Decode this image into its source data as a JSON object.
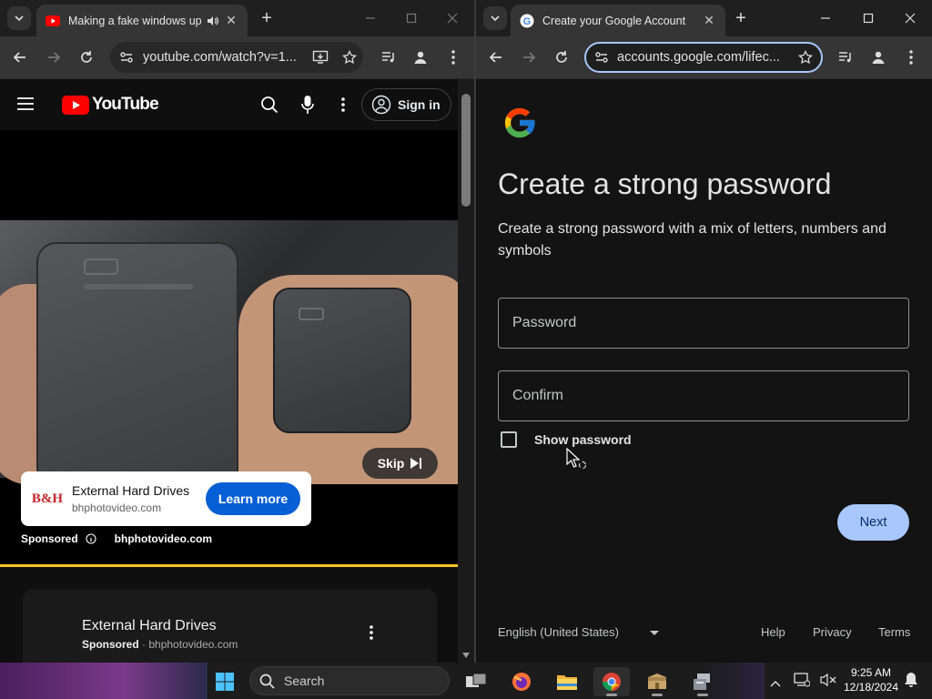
{
  "left_window": {
    "tab_title": "Making a fake windows up",
    "url": "youtube.com/watch?v=1...",
    "youtube": {
      "logo_text": "YouTube",
      "sign_in": "Sign in",
      "ad": {
        "advertiser_logo": "B&H",
        "title": "External Hard Drives",
        "domain": "bhphotovideo.com",
        "cta": "Learn more",
        "skip": "Skip",
        "sponsored": "Sponsored",
        "sponsored_domain": "bhphotovideo.com",
        "progress": 1.0
      },
      "card": {
        "title": "External Hard Drives",
        "sponsored": "Sponsored",
        "domain": "bhphotovideo.com"
      }
    }
  },
  "right_window": {
    "tab_title": "Create your Google Account",
    "url": "accounts.google.com/lifec...",
    "page": {
      "title": "Create a strong password",
      "subtitle": "Create a strong password with a mix of letters, numbers and symbols",
      "password_placeholder": "Password",
      "confirm_placeholder": "Confirm",
      "show_password": "Show password",
      "next": "Next",
      "language": "English (United States)",
      "help": "Help",
      "privacy": "Privacy",
      "terms": "Terms"
    }
  },
  "taskbar": {
    "search_label": "Search",
    "time": "9:25 AM",
    "date": "12/18/2024"
  },
  "colors": {
    "youtube_red": "#ff0000",
    "learn_more_blue": "#065fd4",
    "google_next": "#a8c7fa",
    "ad_progress": "#f9c425"
  }
}
